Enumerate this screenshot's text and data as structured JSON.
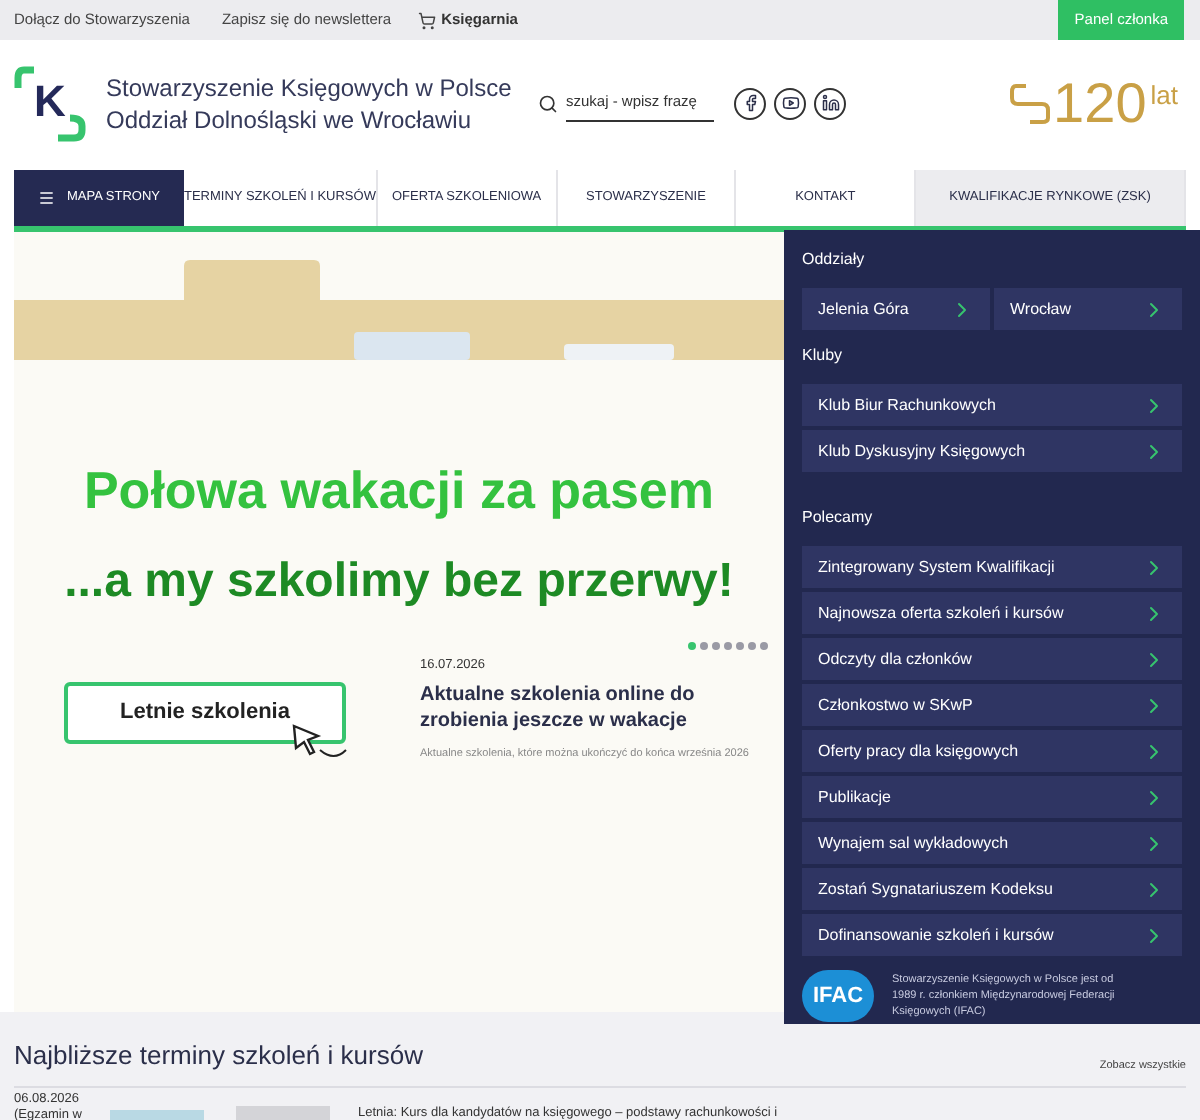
{
  "top_bar": {
    "links": [
      "Dołącz do Stowarzyszenia",
      "Zapisz się do newslettera"
    ],
    "shop": "Księgarnia",
    "member_panel": "Panel członka"
  },
  "header": {
    "logo_letter": "K",
    "org_name": [
      "Stowarzyszenie Księgowych w Polsce",
      "Oddział Dolnośląski we Wrocławiu"
    ],
    "search": {
      "placeholder": "szukaj - wpisz frazę"
    },
    "anniversary": {
      "number": "120",
      "unit": "lat"
    }
  },
  "nav": {
    "menu_button": {
      "label": "MAPA STRONY",
      "expanded": true
    },
    "items": [
      {
        "label": "TERMINY SZKOLEŃ I KURSÓW",
        "kind": "link"
      },
      {
        "label": "OFERTA SZKOLENIOWA",
        "kind": "link"
      },
      {
        "label": "STOWARZYSZENIE",
        "kind": "link"
      },
      {
        "label": "KONTAKT",
        "kind": "link"
      },
      {
        "label": "KWALIFIKACJE RYNKOWE (ZSK)",
        "kind": "accent"
      }
    ]
  },
  "hero": {
    "headline": "Połowa wakacji za pasem",
    "subline": "...a my szkolimy bez przerwy!",
    "button": "Letnie szkolenia",
    "dots": [
      {
        "selected": true
      },
      {
        "selected": false
      },
      {
        "selected": false
      },
      {
        "selected": false
      },
      {
        "selected": false
      },
      {
        "selected": false
      },
      {
        "selected": false
      }
    ],
    "slide": {
      "date": "16.07.2026",
      "title": "Aktualne szkolenia online do zrobienia jeszcze w wakacje",
      "description": "Aktualne szkolenia, które można ukończyć do końca września 2026"
    }
  },
  "panel": {
    "sections": [
      {
        "title": "Oddziały",
        "kind": "pair",
        "items": [
          "Jelenia Góra",
          "Wrocław"
        ]
      },
      {
        "title": "Kluby",
        "kind": "list",
        "items": [
          "Klub Biur Rachunkowych",
          "Klub Dyskusyjny Księgowych"
        ]
      },
      {
        "title": "Polecamy",
        "kind": "list",
        "items": [
          "Zintegrowany System Kwalifikacji",
          "Najnowsza oferta szkoleń i kursów",
          "Odczyty dla członków",
          "Członkostwo w SKwP",
          "Oferty pracy dla księgowych",
          "Publikacje",
          "Wynajem sal wykładowych",
          "Zostań Sygnatariuszem Kodeksu",
          "Dofinansowanie szkoleń i kursów"
        ]
      }
    ],
    "ifac": {
      "logo": "IFAC",
      "text": "Stowarzyszenie Księgowych w Polsce jest od 1989 r. członkiem Międzynarodowej Federacji Księgowych (IFAC)"
    }
  },
  "upcoming": {
    "title": "Najbliższe terminy szkoleń i kursów",
    "see_all": "Zobacz wszystkie",
    "rows": [
      {
        "date": "06.08.2026",
        "note": "(Egzamin w",
        "title": "Letnia: Kurs dla kandydatów na księgowego – podstawy rachunkowości i"
      }
    ]
  }
}
